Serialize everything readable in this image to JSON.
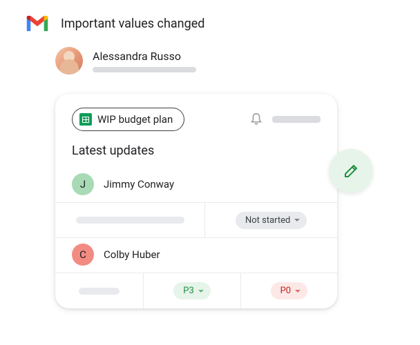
{
  "email": {
    "subject": "Important values changed",
    "sender_name": "Alessandra Russo"
  },
  "card": {
    "doc_name": "WIP budget plan",
    "section_title": "Latest updates",
    "updates": [
      {
        "avatar_letter": "J",
        "name": "Jimmy Conway",
        "status": "Not started"
      },
      {
        "avatar_letter": "C",
        "name": "Colby Huber",
        "priority_old": "P3",
        "priority_new": "P0"
      }
    ]
  }
}
